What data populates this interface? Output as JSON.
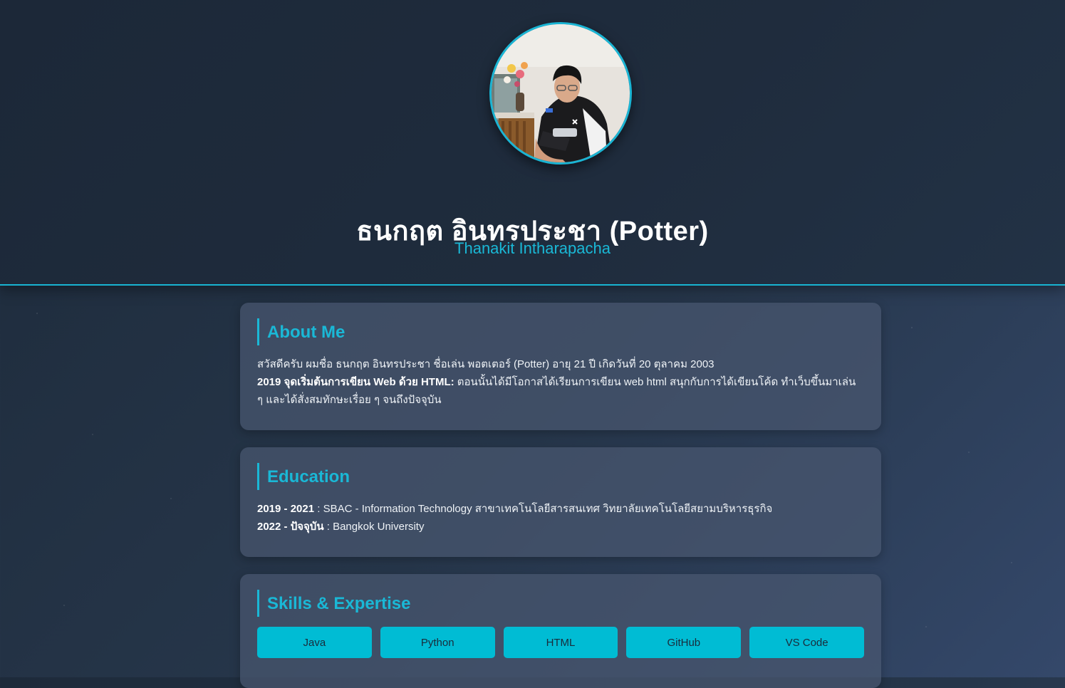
{
  "profile": {
    "name_th": "ธนกฤต อินทรประชา (Potter)",
    "name_en": "Thanakit Intharapacha"
  },
  "about": {
    "title": "About Me",
    "intro": "สวัสดีครับ ผมชื่อ ธนกฤต อินทรประชา ชื่อเล่น พอตเตอร์ (Potter) อายุ 21 ปี เกิดวันที่ 20 ตุลาคม 2003",
    "highlight_label": "2019 จุดเริ่มต้นการเขียน Web ด้วย HTML:",
    "highlight_text": " ตอนนั้นได้มีโอกาสได้เรียนการเขียน web html สนุกกับการได้เขียนโค้ด ทำเว็บขึ้นมาเล่น ๆ และได้สั่งสมทักษะเรื่อย ๆ จนถึงปัจจุบัน"
  },
  "education": {
    "title": "Education",
    "entries": [
      {
        "years": "2019 - 2021",
        "detail": " : SBAC - Information Technology สาขาเทคโนโลยีสารสนเทศ วิทยาลัยเทคโนโลยีสยามบริหารธุรกิจ"
      },
      {
        "years": "2022 - ปัจจุบัน",
        "detail": " : Bangkok University"
      }
    ]
  },
  "skills": {
    "title": "Skills & Expertise",
    "items": [
      "Java",
      "Python",
      "HTML",
      "GitHub",
      "VS Code"
    ]
  },
  "colors": {
    "accent": "#1ab8d6",
    "button": "#00bcd4",
    "header_bg": "#1f2c3d",
    "card_bg": "#4a5870"
  }
}
